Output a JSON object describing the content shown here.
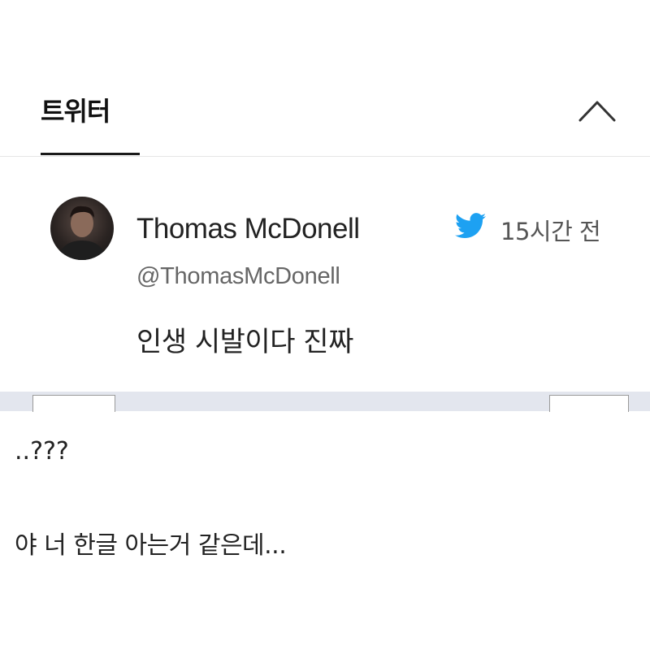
{
  "header": {
    "title": "트위터"
  },
  "tweet": {
    "author_name": "Thomas McDonell",
    "handle": "@ThomasMcDonell",
    "timestamp": "15시간 전",
    "text": "인생 시발이다 진짜",
    "bird_color": "#1da1f2"
  },
  "captions": {
    "line1": "..???",
    "line2": "야 너 한글 아는거 같은데..."
  }
}
